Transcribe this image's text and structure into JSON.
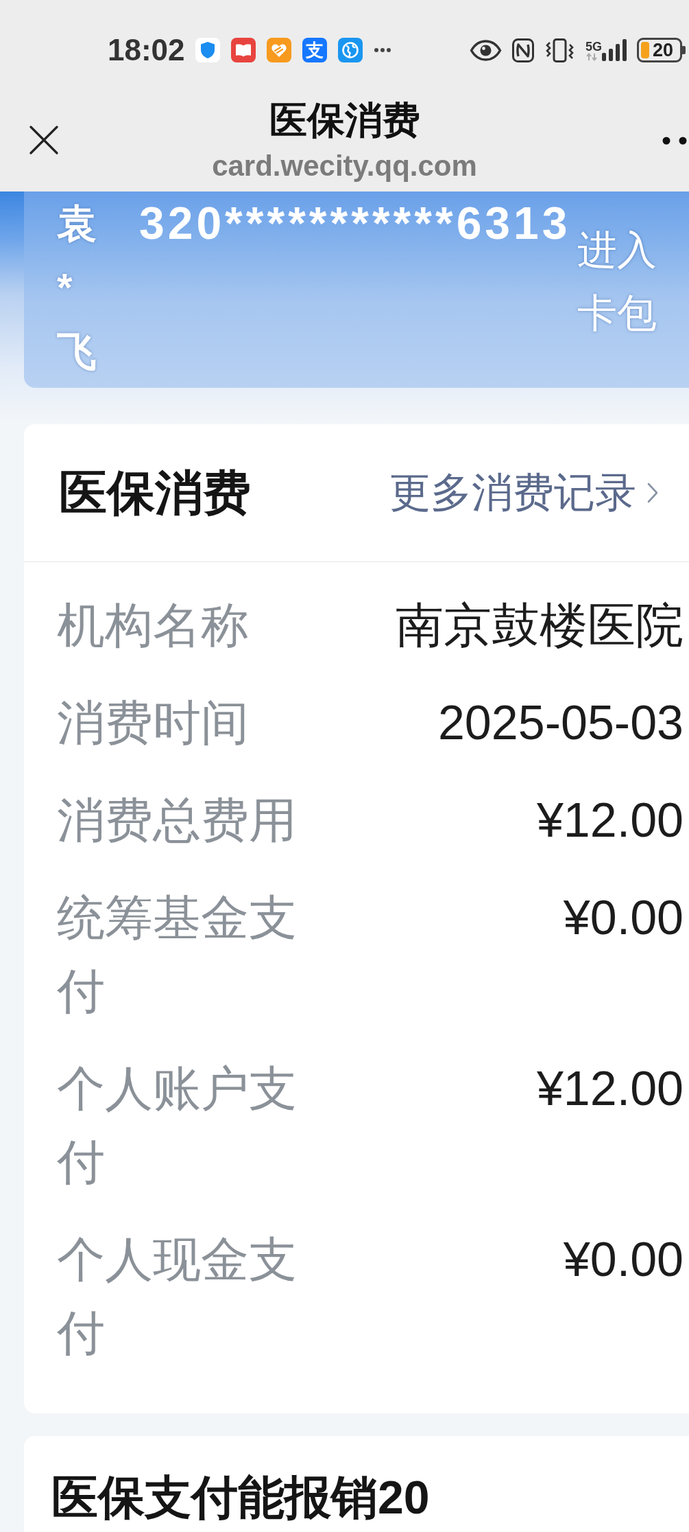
{
  "status_bar": {
    "time": "18:02",
    "app_glyph": "支",
    "network": "5G",
    "battery": "20"
  },
  "browser_bar": {
    "title": "医保消费",
    "url": "card.wecity.qq.com"
  },
  "member_card": {
    "name": "袁*飞",
    "id_number": "320***********6313",
    "action": "进入卡包"
  },
  "consumption_card": {
    "title": "医保消费",
    "more_link": "更多消费记录",
    "rows": [
      {
        "label": "机构名称",
        "value": "南京鼓楼医院"
      },
      {
        "label": "消费时间",
        "value": "2025-05-03"
      },
      {
        "label": "消费总费用",
        "value": "¥12.00"
      },
      {
        "label": "统筹基金支付",
        "value": "¥0.00"
      },
      {
        "label": "个人账户支付",
        "value": "¥12.00"
      },
      {
        "label": "个人现金支付",
        "value": "¥0.00"
      }
    ]
  },
  "reimbursement_card": {
    "title": "医保支付能报销20"
  }
}
